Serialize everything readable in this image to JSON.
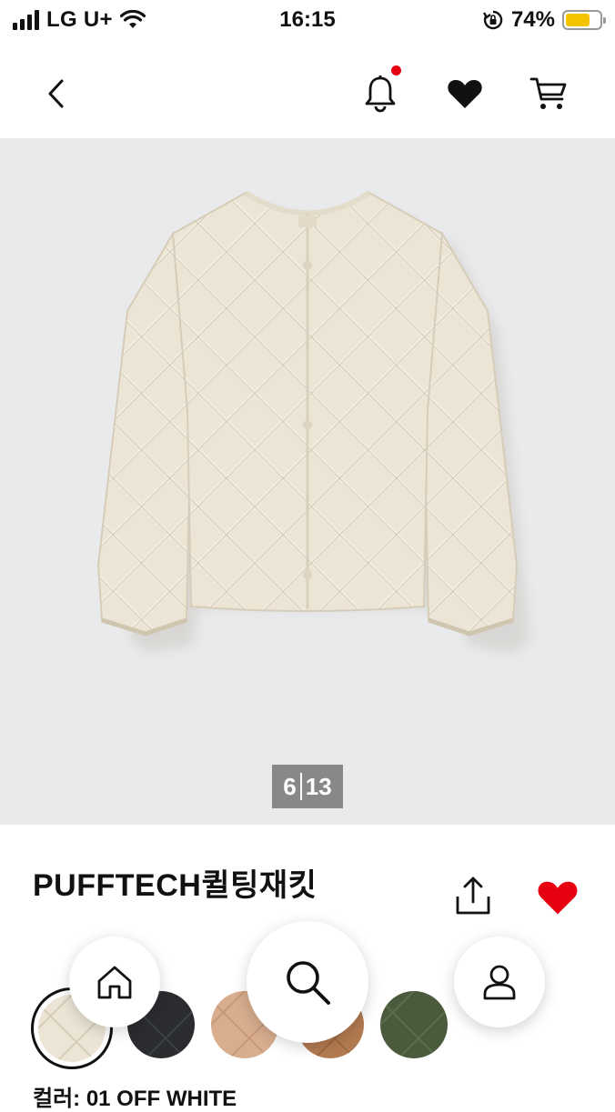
{
  "status_bar": {
    "carrier": "LG U+",
    "time": "16:15",
    "battery_percent": "74%",
    "battery_level": 0.74
  },
  "nav": {
    "icons": [
      "back-icon",
      "bell-icon",
      "heart-icon",
      "cart-icon"
    ],
    "has_notification": true
  },
  "gallery": {
    "current": "6",
    "total": "13"
  },
  "product": {
    "title": "PUFFTECH퀼팅재킷"
  },
  "swatches": [
    {
      "name": "off-white",
      "color": "#ece5d6"
    },
    {
      "name": "black",
      "color": "#2a2c30"
    },
    {
      "name": "beige",
      "color": "#d8ae8e"
    },
    {
      "name": "brown",
      "color": "#b27a50"
    },
    {
      "name": "olive",
      "color": "#4a5a3d"
    }
  ],
  "selected_color_label": "컬러: 01 OFF WHITE",
  "tabbar": {
    "icons": [
      "home-icon",
      "search-icon",
      "user-icon"
    ]
  },
  "colors": {
    "accent_red": "#e60012",
    "image_bg": "#e9eaec",
    "counter_bg": "#888888"
  }
}
